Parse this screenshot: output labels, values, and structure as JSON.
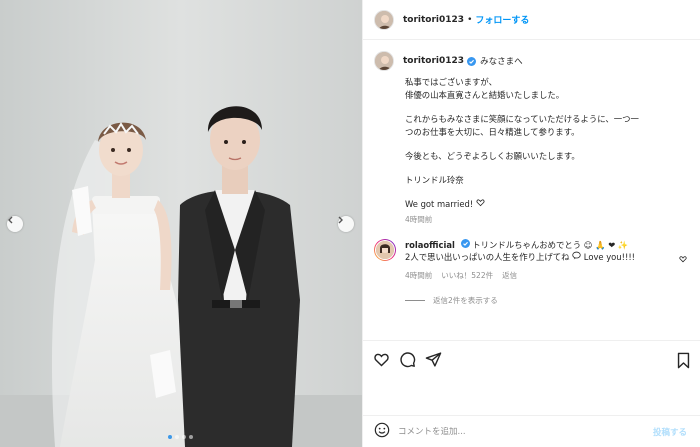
{
  "post": {
    "username": "toritori0123",
    "separator": "•",
    "follow_label": "フォローする"
  },
  "caption": {
    "username": "toritori0123",
    "intro": "みなさまへ",
    "lines": [
      "私事ではございますが、",
      "俳優の山本直寛さんと結婚いたしました。",
      "これからもみなさまに笑顔になっていただけるように、一つ一",
      "つのお仕事を大切に、日々精進して参ります。",
      "今後とも、どうぞよろしくお願いいたします。",
      "トリンドル玲奈",
      "We got married!"
    ],
    "time": "4時間前"
  },
  "comment": {
    "username": "rolaofficial",
    "text_line1": "トリンドルちゃんおめでとう",
    "text_line2": "2人で思い出いっぱいの人生を作り上げてね",
    "text_tail": "Love you!!!!",
    "time": "4時間前",
    "likes": "いいね！522件",
    "reply_label": "返信",
    "view_replies": "返信2件を表示する"
  },
  "composer": {
    "placeholder": "コメントを追加...",
    "post_label": "投稿する"
  },
  "carousel": {
    "slide_count": 4,
    "current_slide": 1
  },
  "colors": {
    "accent": "#0095f6",
    "verified": "#3897f0",
    "muted": "#8e8e8e",
    "text": "#262626"
  },
  "icons": {
    "like": "heart-icon",
    "comment": "comment-icon",
    "share": "paper-plane-icon",
    "save": "bookmark-icon",
    "emoji": "smiley-icon",
    "verified": "verified-badge-icon"
  }
}
